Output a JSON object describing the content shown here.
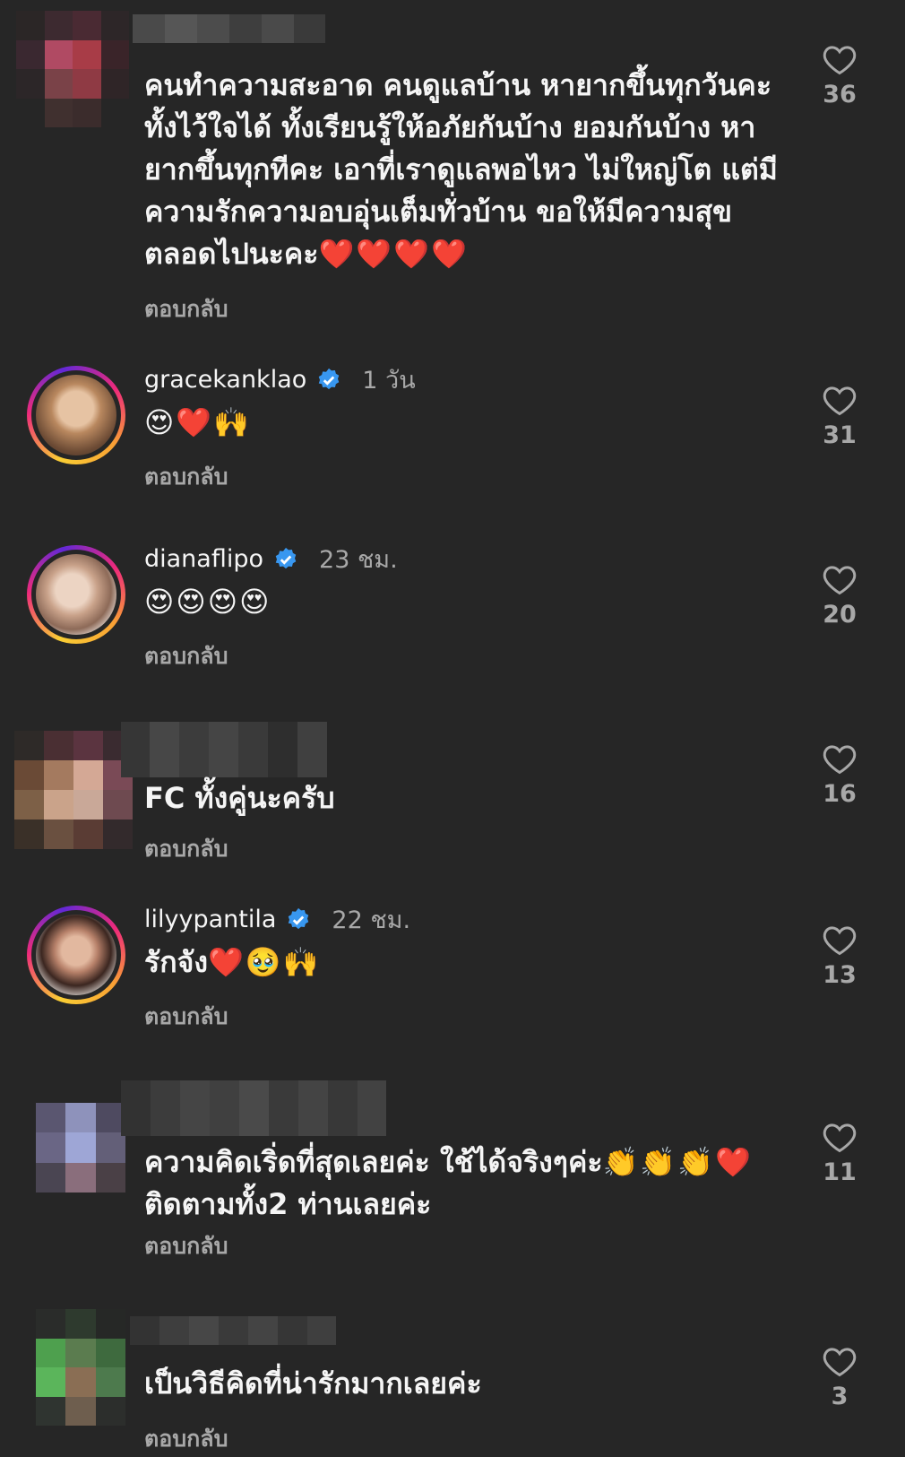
{
  "comments": [
    {
      "text": "คนทำความสะอาด คนดูแลบ้าน หายากขึ้นทุกวันคะ ทั้งไว้ใจได้ ทั้งเรียนรู้ให้อภัยกันบ้าง ยอมกันบ้าง หายากขึ้นทุกทีคะ เอาที่เราดูแลพอไหว ไม่ใหญ่โต แต่มีความรักความอบอุ่นเต็มทั่วบ้าน ขอให้มีความสุขตลอดไปนะคะ",
      "emoji": "❤️❤️❤️❤️",
      "reply": "ตอบกลับ",
      "likes": "36"
    },
    {
      "username": "gracekanklao",
      "time": "1 วัน",
      "emoji": "😍❤️🙌",
      "reply": "ตอบกลับ",
      "likes": "31"
    },
    {
      "username": "dianaflipo",
      "time": "23 ชม.",
      "emoji": "😍😍😍😍",
      "reply": "ตอบกลับ",
      "likes": "20"
    },
    {
      "text": "FC ทั้งคู่นะครับ",
      "reply": "ตอบกลับ",
      "likes": "16"
    },
    {
      "username": "lilyypantila",
      "time": "22 ชม.",
      "text": "รักจัง",
      "emoji": "❤️🥹🙌",
      "reply": "ตอบกลับ",
      "likes": "13"
    },
    {
      "text": "ความคิดเริ่ดที่สุดเลยค่ะ ใช้ได้จริงๆค่ะ",
      "emoji": "👏👏👏❤️",
      "text2": "ติดตามทั้ง2 ท่านเลยค่ะ",
      "reply": "ตอบกลับ",
      "likes": "11"
    },
    {
      "text": "เป็นวิธีคิดที่น่ารักมากเลยค่ะ",
      "reply": "ตอบกลับ",
      "likes": "3"
    }
  ],
  "icons": {
    "like": "heart-outline-icon",
    "verified": "verified-badge-icon"
  },
  "colors": {
    "background": "#262626",
    "text": "#f5f5f5",
    "muted": "#a8a8a8",
    "verified": "#3897f0",
    "heart": "#ed1c3c"
  }
}
